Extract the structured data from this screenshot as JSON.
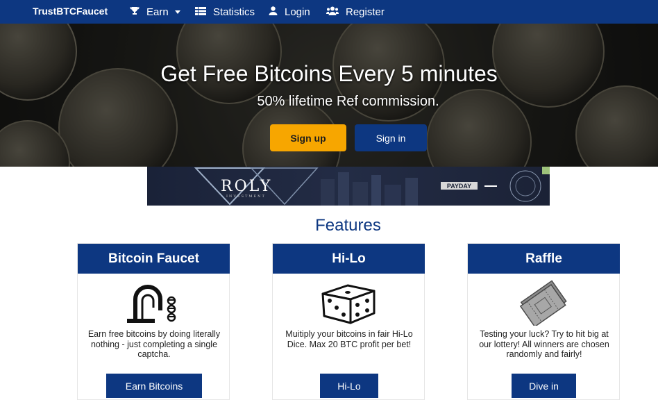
{
  "navbar": {
    "brand": "TrustBTCFaucet",
    "items": [
      {
        "label": "Earn",
        "icon": "trophy-icon",
        "has_caret": true
      },
      {
        "label": "Statistics",
        "icon": "table-icon"
      },
      {
        "label": "Login",
        "icon": "user-icon"
      },
      {
        "label": "Register",
        "icon": "users-icon"
      }
    ]
  },
  "hero": {
    "title": "Get Free Bitcoins Every 5 minutes",
    "subtitle": "50% lifetime Ref commission.",
    "signup_label": "Sign up",
    "signin_label": "Sign in"
  },
  "ad": {
    "logo": "ROLY",
    "tagline": "INVESTMENT",
    "badge": "PAYDAY"
  },
  "features": {
    "title": "Features",
    "cards": [
      {
        "title": "Bitcoin Faucet",
        "icon": "faucet-icon",
        "text": "Earn free bitcoins by doing literally nothing - just completing a single captcha.",
        "button": "Earn Bitcoins"
      },
      {
        "title": "Hi-Lo",
        "icon": "dice-icon",
        "text": "Muitiply your bitcoins in fair Hi-Lo Dice. Max 20 BTC profit per bet!",
        "button": "Hi-Lo"
      },
      {
        "title": "Raffle",
        "icon": "ticket-icon",
        "text": "Testing your luck? Try to hit big at our lottery! All winners are chosen randomly and fairly!",
        "button": "Dive in"
      }
    ]
  },
  "colors": {
    "primary": "#0d3781",
    "accent": "#f7a600"
  }
}
